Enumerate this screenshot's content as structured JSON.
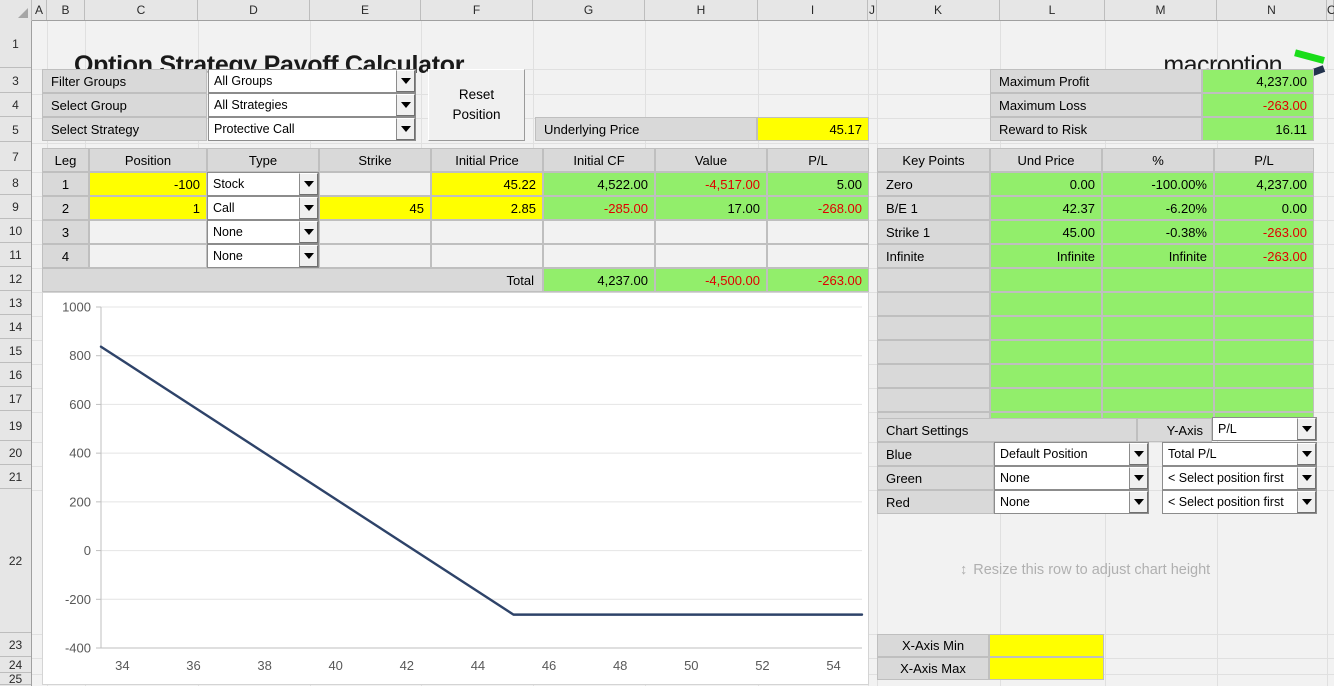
{
  "app": {
    "title": "Option Strategy Payoff Calculator",
    "logo_word": "macroption"
  },
  "columns": [
    "A",
    "B",
    "C",
    "D",
    "E",
    "F",
    "G",
    "H",
    "I",
    "J",
    "K",
    "L",
    "M",
    "N",
    "O"
  ],
  "rows": [
    "1",
    "3",
    "4",
    "5",
    "7",
    "8",
    "9",
    "10",
    "11",
    "12",
    "13",
    "14",
    "15",
    "16",
    "17",
    "19",
    "20",
    "21",
    "22",
    "23",
    "24",
    "25"
  ],
  "selectors": {
    "filter_groups_label": "Filter Groups",
    "filter_groups_value": "All Groups",
    "select_group_label": "Select Group",
    "select_group_value": "All Strategies",
    "select_strategy_label": "Select Strategy",
    "select_strategy_value": "Protective Call",
    "reset_button_line1": "Reset",
    "reset_button_line2": "Position",
    "underlying_price_label": "Underlying Price",
    "underlying_price_value": "45.17"
  },
  "legs_table": {
    "headers": [
      "Leg",
      "Position",
      "Type",
      "Strike",
      "Initial Price",
      "Initial CF",
      "Value",
      "P/L"
    ],
    "rows": [
      {
        "leg": "1",
        "position": "-100",
        "type": "Stock",
        "strike": "",
        "initial_price": "45.22",
        "initial_cf": "4,522.00",
        "value": "-4,517.00",
        "pl": "5.00"
      },
      {
        "leg": "2",
        "position": "1",
        "type": "Call",
        "strike": "45",
        "initial_price": "2.85",
        "initial_cf": "-285.00",
        "value": "17.00",
        "pl": "-268.00"
      },
      {
        "leg": "3",
        "position": "",
        "type": "None",
        "strike": "",
        "initial_price": "",
        "initial_cf": "",
        "value": "",
        "pl": ""
      },
      {
        "leg": "4",
        "position": "",
        "type": "None",
        "strike": "",
        "initial_price": "",
        "initial_cf": "",
        "value": "",
        "pl": ""
      }
    ],
    "total_label": "Total",
    "total_initial_cf": "4,237.00",
    "total_value": "-4,500.00",
    "total_pl": "-263.00"
  },
  "summary": {
    "max_profit_label": "Maximum Profit",
    "max_profit_value": "4,237.00",
    "max_loss_label": "Maximum Loss",
    "max_loss_value": "-263.00",
    "reward_risk_label": "Reward to Risk",
    "reward_risk_value": "16.11"
  },
  "key_points": {
    "headers": [
      "Key Points",
      "Und Price",
      "%",
      "P/L"
    ],
    "rows": [
      {
        "name": "Zero",
        "und_price": "0.00",
        "pct": "-100.00%",
        "pl": "4,237.00"
      },
      {
        "name": "B/E 1",
        "und_price": "42.37",
        "pct": "-6.20%",
        "pl": "0.00"
      },
      {
        "name": "Strike 1",
        "und_price": "45.00",
        "pct": "-0.38%",
        "pl": "-263.00"
      },
      {
        "name": "Infinite",
        "und_price": "Infinite",
        "pct": "Infinite",
        "pl": "-263.00"
      }
    ],
    "empty_row_count": 7
  },
  "chart_settings": {
    "title": "Chart Settings",
    "y_axis_label": "Y-Axis",
    "y_axis_value": "P/L",
    "series": [
      {
        "color_label": "Blue",
        "position": "Default Position",
        "metric": "Total P/L"
      },
      {
        "color_label": "Green",
        "position": "None",
        "metric": "< Select position first"
      },
      {
        "color_label": "Red",
        "position": "None",
        "metric": "< Select position first"
      }
    ]
  },
  "resize_hint": "Resize this row to adjust chart height",
  "x_axis_controls": {
    "min_label": "X-Axis Min",
    "min_value": "",
    "max_label": "X-Axis Max",
    "max_value": ""
  },
  "colors": {
    "highlight_yellow": "#ffff00",
    "result_green": "#92ee6b",
    "negative_red": "#e00000",
    "label_grey": "#d9d9d9",
    "chart_line_blue": "#2e4369"
  },
  "chart_data": {
    "type": "line",
    "title": "",
    "xlabel": "",
    "ylabel": "",
    "xlim": [
      33.4,
      54.8
    ],
    "ylim": [
      -400,
      1000
    ],
    "xticks": [
      34,
      36,
      38,
      40,
      42,
      44,
      46,
      48,
      50,
      52,
      54
    ],
    "yticks": [
      -400,
      -200,
      0,
      200,
      400,
      600,
      800,
      1000
    ],
    "grid": true,
    "legend": null,
    "series": [
      {
        "name": "Total P/L",
        "color": "#2e4369",
        "x": [
          33.4,
          45.0,
          54.8
        ],
        "values": [
          837,
          -263,
          -263
        ]
      }
    ]
  }
}
